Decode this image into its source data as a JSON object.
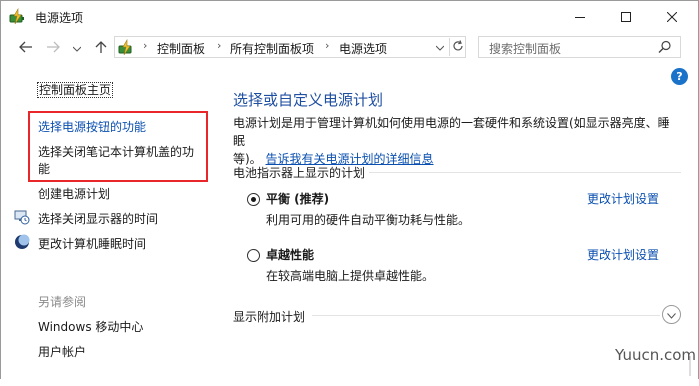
{
  "window": {
    "title": "电源选项",
    "minimize_icon": "minimize-icon",
    "maximize_icon": "maximize-icon",
    "close_icon": "close-icon"
  },
  "nav": {
    "breadcrumb": [
      "控制面板",
      "所有控制面板项",
      "电源选项"
    ],
    "separator": "›",
    "search_placeholder": "搜索控制面板"
  },
  "sidebar": {
    "home": "控制面板主页",
    "links": [
      {
        "label": "选择电源按钮的功能",
        "icon": null
      },
      {
        "label": "选择关闭笔记本计算机盖的功",
        "icon": null
      },
      {
        "label": "能",
        "icon": null
      },
      {
        "label": "创建电源计划",
        "icon": null
      },
      {
        "label": "选择关闭显示器的时间",
        "icon": "monitor-clock-icon"
      },
      {
        "label": "更改计算机睡眠时间",
        "icon": "moon-icon"
      }
    ],
    "see_also_title": "另请参阅",
    "see_also": [
      "Windows 移动中心",
      "用户帐户"
    ]
  },
  "main": {
    "title": "选择或自定义电源计划",
    "description_line1": "电源计划是用于管理计算机如何使用电源的一套硬件和系统设置(如显示器亮度、睡眠",
    "description_line2_prefix": "等)。",
    "description_link": "告诉我有关电源计划的详细信息",
    "battery_section_label": "电池指示器上显示的计划",
    "plans": [
      {
        "name": "平衡 (推荐)",
        "description": "利用可用的硬件自动平衡功耗与性能。",
        "action": "更改计划设置",
        "selected": true
      },
      {
        "name": "卓越性能",
        "description": "在较高端电脑上提供卓越性能。",
        "action": "更改计划设置",
        "selected": false
      }
    ],
    "extra_plans_label": "显示附加计划"
  },
  "help": "?",
  "watermark": "Yuucn.com",
  "colors": {
    "link": "#0a4fb0",
    "title": "#1f4fa1",
    "highlight_box": "#e8272b",
    "help": "#1a73c9"
  }
}
